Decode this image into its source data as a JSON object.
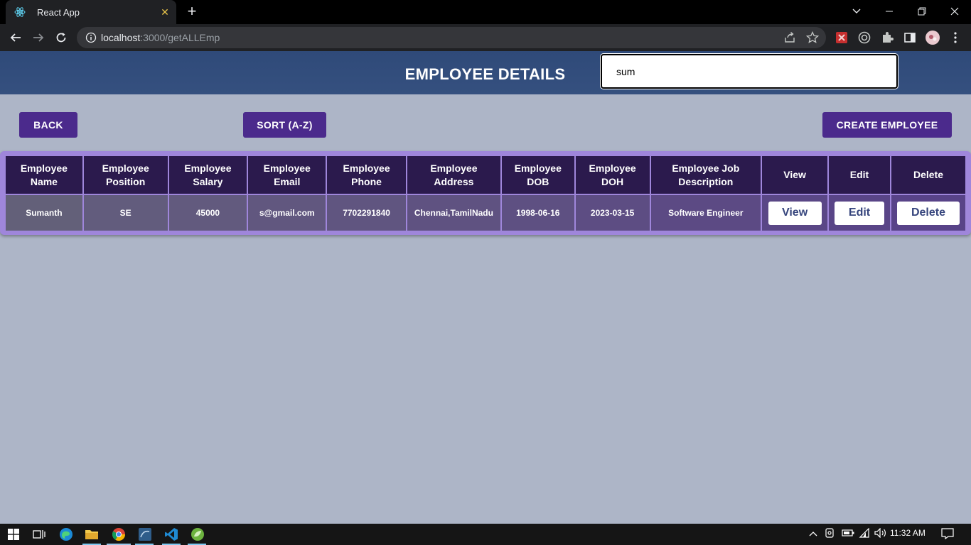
{
  "browser": {
    "tab_title": "React App",
    "tab_close": "✕",
    "new_tab": "+",
    "url_host": "localhost",
    "url_path": ":3000/getALLEmp"
  },
  "header": {
    "title": "EMPLOYEE DETAILS",
    "search_value": "sum"
  },
  "actions": {
    "back": "BACK",
    "sort": "SORT (A-Z)",
    "create": "CREATE EMPLOYEE"
  },
  "table": {
    "headers": [
      "Employee Name",
      "Employee Position",
      "Employee Salary",
      "Employee Email",
      "Employee Phone",
      "Employee Address",
      "Employee DOB",
      "Employee DOH",
      "Employee Job Description",
      "View",
      "Edit",
      "Delete"
    ],
    "rows": [
      {
        "name": "Sumanth",
        "position": "SE",
        "salary": "45000",
        "email": "s@gmail.com",
        "phone": "7702291840",
        "address": "Chennai,TamilNadu",
        "dob": "1998-06-16",
        "doh": "2023-03-15",
        "job": "Software Engineer",
        "view_label": "View",
        "edit_label": "Edit",
        "delete_label": "Delete"
      }
    ]
  },
  "taskbar": {
    "time": "11:32 AM"
  },
  "colors": {
    "header_bg": "#2f4a79",
    "page_bg": "#adb5c7",
    "button_bg": "#4b2a8c",
    "table_header_bg": "#2b1a4d",
    "table_border": "#9f86db"
  }
}
